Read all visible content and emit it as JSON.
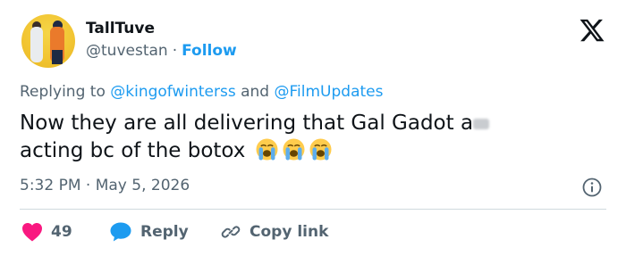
{
  "author": {
    "name": "TallTuve",
    "handle": "@tuvestan",
    "separator": "·",
    "follow_label": "Follow"
  },
  "reply_context": {
    "prefix": "Replying to",
    "mention1": "@kingofwinterss",
    "conjunction": "and",
    "mention2": "@FilmUpdates"
  },
  "tweet": {
    "line1": "Now they are all delivering that Gal Gadot a",
    "line2": "acting bc of the botox",
    "emojis": [
      "loudly-crying-face",
      "loudly-crying-face",
      "loudly-crying-face"
    ]
  },
  "meta": {
    "time": "5:32 PM",
    "separator": "·",
    "date": "May 5, 2026"
  },
  "actions": {
    "like_count": "49",
    "reply_label": "Reply",
    "copy_label": "Copy link"
  },
  "colors": {
    "accent": "#1d9bf0",
    "like": "#f91880",
    "muted": "#536471",
    "text": "#0f1419"
  }
}
